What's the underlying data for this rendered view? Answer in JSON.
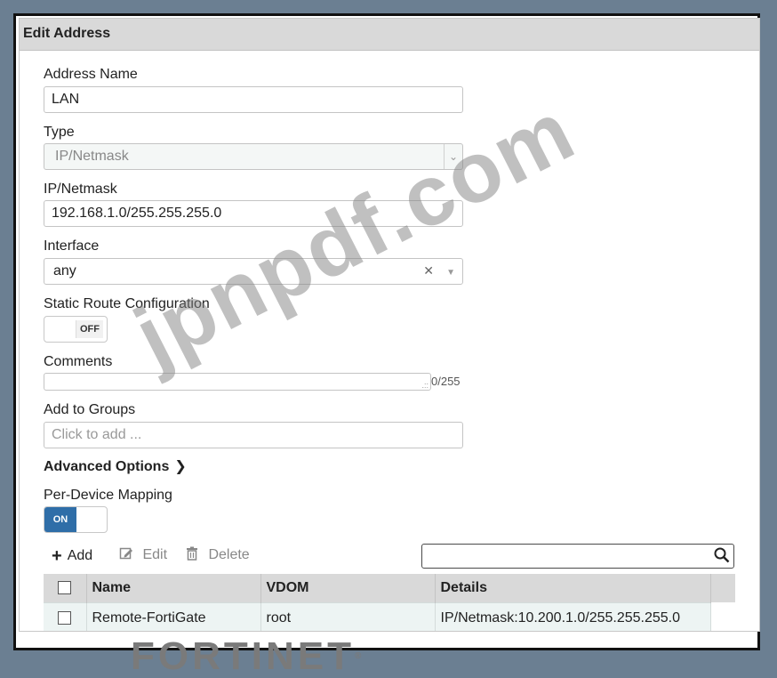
{
  "dialog": {
    "title": "Edit Address"
  },
  "form": {
    "address_name": {
      "label": "Address Name",
      "value": "LAN"
    },
    "type": {
      "label": "Type",
      "value": "IP/Netmask"
    },
    "ip_netmask": {
      "label": "IP/Netmask",
      "value": "192.168.1.0/255.255.255.0"
    },
    "interface": {
      "label": "Interface",
      "value": "any"
    },
    "static_route": {
      "label": "Static Route Configuration",
      "state": "OFF"
    },
    "comments": {
      "label": "Comments",
      "value": "",
      "counter": "0/255"
    },
    "groups": {
      "label": "Add to Groups",
      "placeholder": "Click to add ..."
    },
    "advanced_options": {
      "label": "Advanced Options"
    },
    "per_device": {
      "label": "Per-Device Mapping",
      "state": "ON"
    }
  },
  "toolbar": {
    "add_label": "Add",
    "edit_label": "Edit",
    "delete_label": "Delete"
  },
  "table": {
    "columns": [
      "Name",
      "VDOM",
      "Details"
    ],
    "rows": [
      {
        "name": "Remote-FortiGate",
        "vdom": "root",
        "details": "IP/Netmask:10.200.1.0/255.255.255.0"
      }
    ]
  },
  "watermark": "jpnpdf.com",
  "logo": {
    "text": "FORTINET",
    "mark": "®"
  },
  "colors": {
    "header_bg": "#d9d9d9",
    "toggle_on": "#2f6ea8",
    "row_bg": "#edf4f3",
    "backdrop": "#6b7f92"
  },
  "icons": {
    "add": "plus-icon",
    "edit": "pencil-icon",
    "delete": "trash-icon",
    "search": "magnifier-icon"
  }
}
